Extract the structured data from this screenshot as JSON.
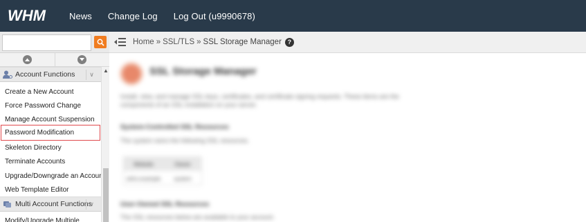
{
  "topbar": {
    "logo": "WHM",
    "nav": [
      "News",
      "Change Log",
      "Log Out (u9990678)"
    ]
  },
  "sidebar": {
    "search": {
      "value": "",
      "placeholder": ""
    },
    "sections": [
      {
        "label": "Account Functions",
        "items": [
          "Create a New Account",
          "Force Password Change",
          "Manage Account Suspension",
          "Password Modification",
          "Skeleton Directory",
          "Terminate Accounts",
          "Upgrade/Downgrade an Account",
          "Web Template Editor"
        ]
      },
      {
        "label": "Multi Account Functions",
        "items": [
          "Modify/Upgrade Multiple"
        ]
      }
    ],
    "highlighted_item": "Password Modification"
  },
  "breadcrumb": {
    "home": "Home",
    "section": "SSL/TLS",
    "current": "SSL Storage Manager",
    "separator": "»"
  },
  "page": {
    "title": "SSL Storage Manager",
    "description": "Install, view, and manage SSL keys, certificates, and certificate signing requests. These items are the components of an SSL installation on your server.",
    "sub1_title": "System-Controlled SSL Resources",
    "sub1_text": "The system owns the following SSL resources.",
    "table_headers": [
      "Website",
      "Owner"
    ],
    "table_row": [
      "whm.example",
      "system"
    ],
    "sub2_title": "User-Owned SSL Resources",
    "sub2_text": "The SSL resources below are available to your account."
  },
  "colors": {
    "topbar": "#293a4a",
    "search_button": "#f07c20",
    "highlight_border": "#e0484c"
  }
}
